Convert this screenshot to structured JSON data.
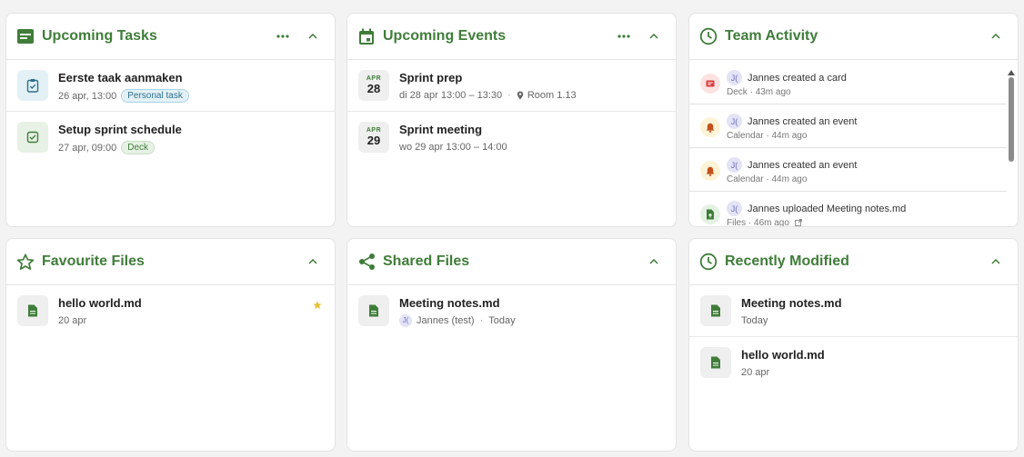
{
  "colors": {
    "accent": "#3f7d39",
    "star": "#e8c23a"
  },
  "upcoming_tasks": {
    "title": "Upcoming Tasks",
    "items": [
      {
        "title": "Eerste taak aanmaken",
        "date": "26 apr, 13:00",
        "badge": "Personal task",
        "icon": "clipboard-icon"
      },
      {
        "title": "Setup sprint schedule",
        "date": "27 apr, 09:00",
        "badge": "Deck",
        "icon": "checkbox-icon"
      }
    ]
  },
  "upcoming_events": {
    "title": "Upcoming Events",
    "items": [
      {
        "month": "APR",
        "day": "28",
        "title": "Sprint prep",
        "time": "di 28 apr 13:00 – 13:30",
        "location": "Room 1.13"
      },
      {
        "month": "APR",
        "day": "29",
        "title": "Sprint meeting",
        "time": "wo 29 apr 13:00 – 14:00"
      }
    ]
  },
  "team_activity": {
    "title": "Team Activity",
    "items": [
      {
        "avatar": "J(",
        "text": "Jannes created a card",
        "app": "Deck",
        "ago": "43m ago",
        "icon": "card-icon"
      },
      {
        "avatar": "J(",
        "text": "Jannes created an event",
        "app": "Calendar",
        "ago": "44m ago",
        "icon": "bell-icon"
      },
      {
        "avatar": "J(",
        "text": "Jannes created an event",
        "app": "Calendar",
        "ago": "44m ago",
        "icon": "bell-icon"
      },
      {
        "avatar": "J(",
        "text": "Jannes uploaded Meeting notes.md",
        "app": "Files",
        "ago": "46m ago",
        "icon": "file-upload-icon"
      }
    ]
  },
  "favourite_files": {
    "title": "Favourite Files",
    "items": [
      {
        "name": "hello world.md",
        "date": "20 apr"
      }
    ]
  },
  "shared_files": {
    "title": "Shared Files",
    "items": [
      {
        "name": "Meeting notes.md",
        "avatar": "J(",
        "owner": "Jannes (test)",
        "date": "Today"
      }
    ]
  },
  "recently_modified": {
    "title": "Recently Modified",
    "items": [
      {
        "name": "Meeting notes.md",
        "date": "Today"
      },
      {
        "name": "hello world.md",
        "date": "20 apr"
      }
    ]
  }
}
